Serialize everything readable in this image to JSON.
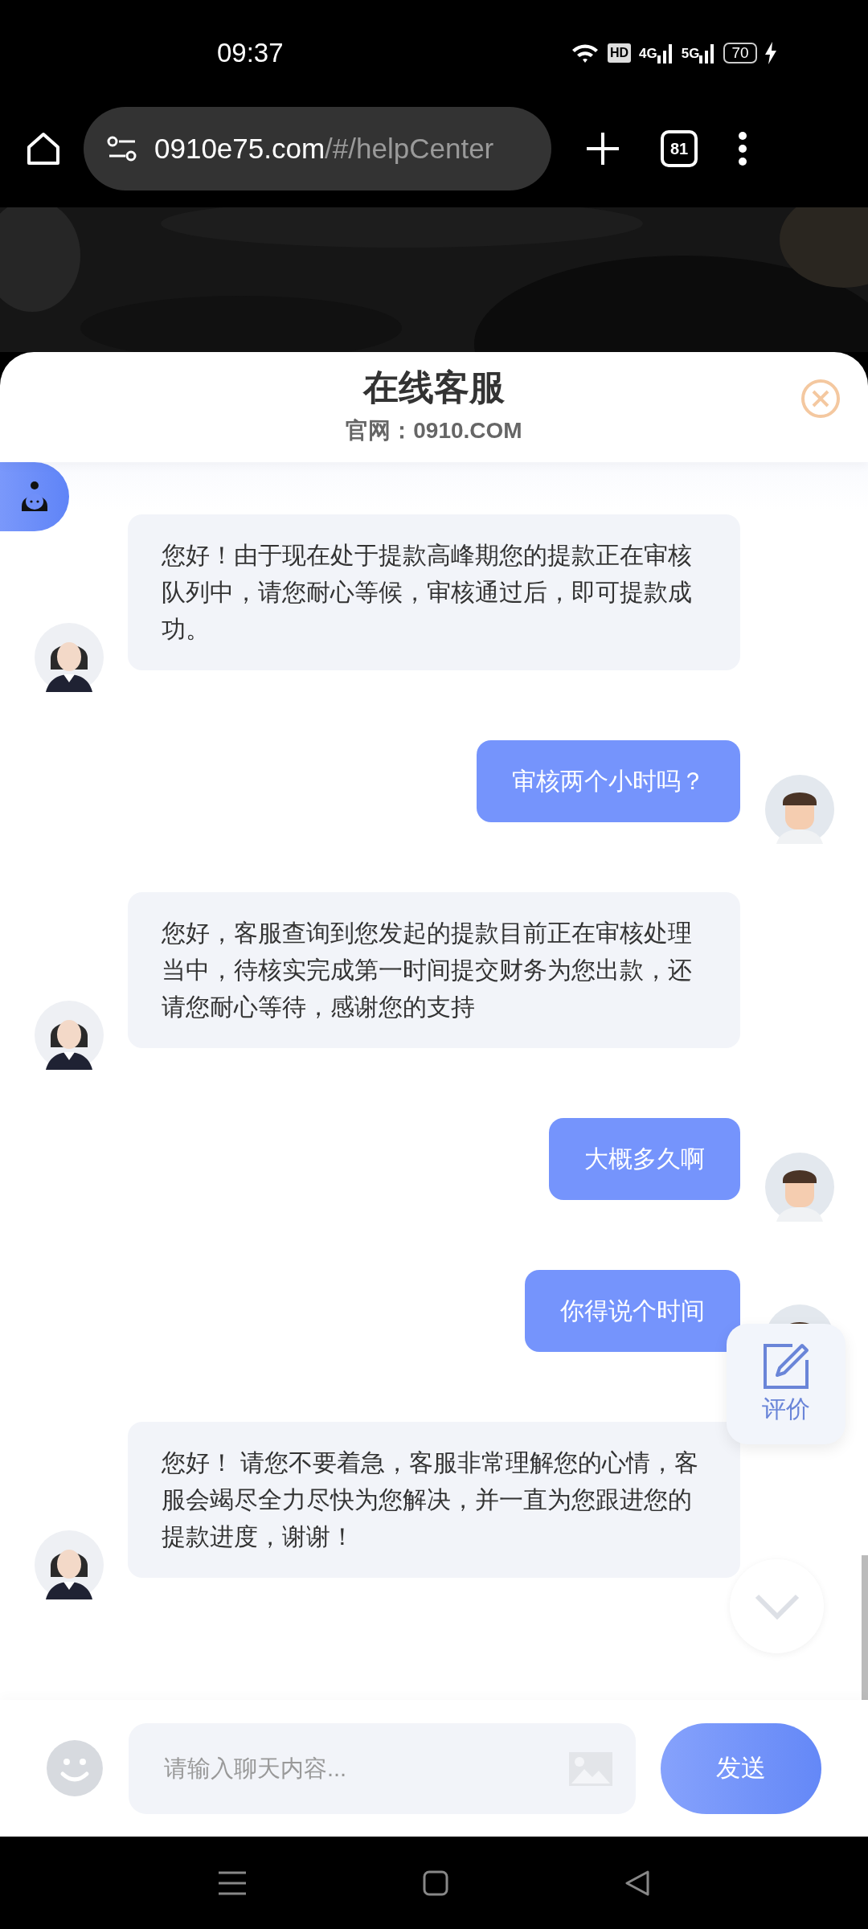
{
  "status_bar": {
    "time": "09:37",
    "hd": "HD",
    "network_1": "4G",
    "network_2": "5G",
    "battery": "70"
  },
  "browser": {
    "url_host": "0910e75.com",
    "url_path": "/#/helpCenter",
    "tab_count": "81"
  },
  "header": {
    "title": "在线客服",
    "subtitle": "官网：0910.COM"
  },
  "messages": [
    {
      "kind": "agent",
      "text": "您好！由于现在处于提款高峰期您的提款正在审核队列中，请您耐心等候，审核通过后，即可提款成功。"
    },
    {
      "kind": "user",
      "text": "审核两个小时吗？"
    },
    {
      "kind": "agent",
      "text": "您好，客服查询到您发起的提款目前正在审核处理当中，待核实完成第一时间提交财务为您出款，还请您耐心等待，感谢您的支持"
    },
    {
      "kind": "user",
      "text": "大概多久啊"
    },
    {
      "kind": "user",
      "text": "你得说个时间"
    },
    {
      "kind": "agent",
      "text": "您好！ 请您不要着急，客服非常理解您的心情，客服会竭尽全力尽快为您解决，并一直为您跟进您的提款进度，谢谢！"
    }
  ],
  "rating_button": {
    "label": "评价"
  },
  "input": {
    "placeholder": "请输入聊天内容..."
  },
  "send_button": {
    "label": "发送"
  }
}
